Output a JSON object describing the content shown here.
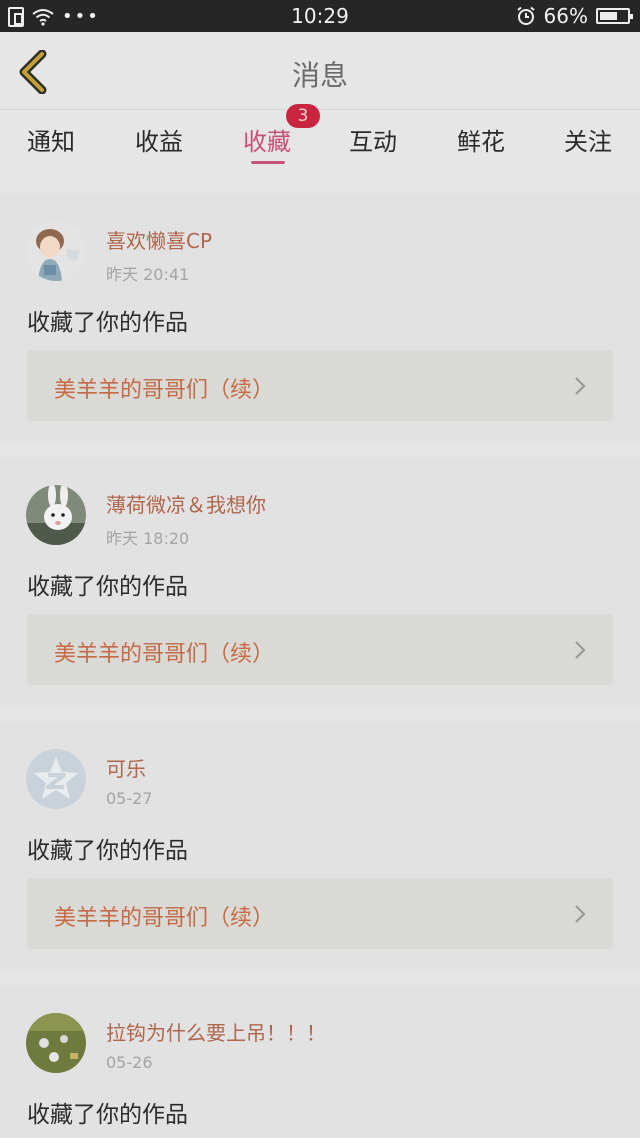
{
  "status_bar": {
    "time": "10:29",
    "battery": "66%",
    "battery_level": 0.66
  },
  "header": {
    "title": "消息"
  },
  "tabs": [
    {
      "label": "通知"
    },
    {
      "label": "收益"
    },
    {
      "label": "收藏",
      "active": true,
      "badge": "3"
    },
    {
      "label": "互动"
    },
    {
      "label": "鲜花"
    },
    {
      "label": "关注"
    }
  ],
  "messages": [
    {
      "user": "喜欢懒喜CP",
      "time": "昨天 20:41",
      "action": "收藏了你的作品",
      "work": "美羊羊的哥哥们（续）"
    },
    {
      "user": "薄荷微凉＆我想你",
      "time": "昨天 18:20",
      "action": "收藏了你的作品",
      "work": "美羊羊的哥哥们（续）"
    },
    {
      "user": "可乐",
      "time": "05-27",
      "action": "收藏了你的作品",
      "work": "美羊羊的哥哥们（续）"
    },
    {
      "user": "拉钩为什么要上吊！！！",
      "time": "05-26",
      "action": "收藏了你的作品"
    }
  ],
  "colors": {
    "accent": "#c75278",
    "badge": "#c9253f",
    "username": "#b0664d",
    "work_title": "#c56a45"
  }
}
